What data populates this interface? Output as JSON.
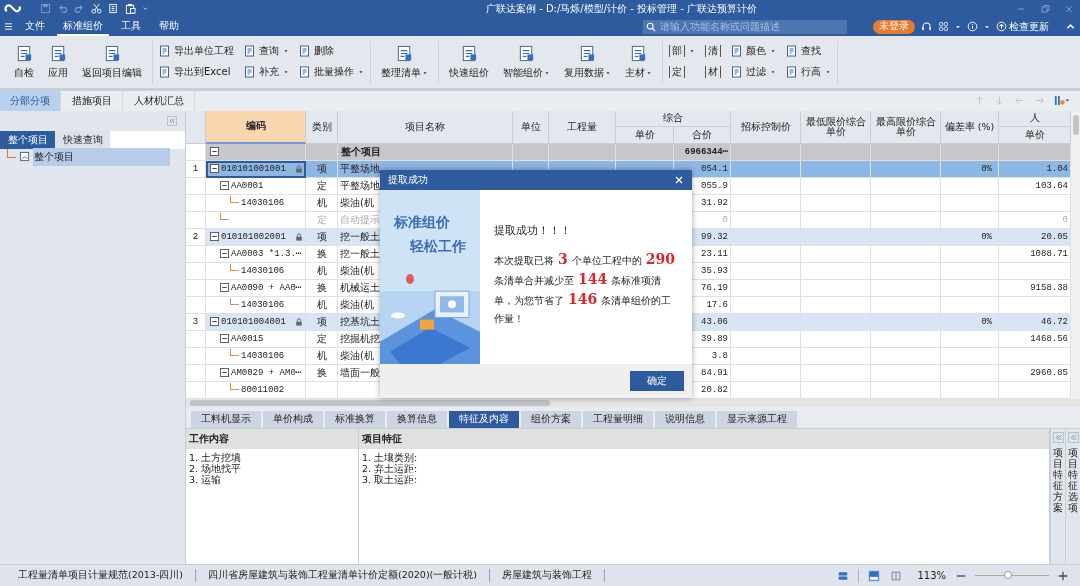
{
  "window": {
    "title": "广联达案例 - D:/马烁/模型/计价 - 投标管理 - 广联达预算计价"
  },
  "menu": [
    {
      "label": "文件",
      "selected": false
    },
    {
      "label": "标准组价",
      "selected": true
    },
    {
      "label": "工具",
      "selected": false
    },
    {
      "label": "帮助",
      "selected": false
    }
  ],
  "search": {
    "placeholder": "请输入功能名称或问题描述"
  },
  "account": {
    "login_label": "未登录",
    "update_label": "检查更新"
  },
  "ribbon": [
    {
      "kind": "large",
      "items": [
        {
          "label": "自检",
          "dropdown": false
        },
        {
          "label": "应用",
          "dropdown": false
        },
        {
          "label": "返回项目编辑",
          "dropdown": false
        }
      ]
    },
    {
      "kind": "small",
      "items": [
        {
          "kind": "text",
          "label": "导出单位工程",
          "dropdown": false
        },
        {
          "kind": "text",
          "label": "导出到Excel",
          "dropdown": false
        },
        {
          "kind": "text",
          "label": "查询",
          "dropdown": true
        },
        {
          "kind": "text",
          "label": "补充",
          "dropdown": true
        },
        {
          "kind": "text",
          "label": "删除",
          "dropdown": false
        },
        {
          "kind": "text",
          "label": "批量操作",
          "dropdown": true
        }
      ]
    },
    {
      "kind": "large",
      "items": [
        {
          "label": "整理清单",
          "dropdown": true
        }
      ]
    },
    {
      "kind": "large",
      "items": [
        {
          "label": "快速组价",
          "dropdown": false
        },
        {
          "label": "智能组价",
          "dropdown": true
        },
        {
          "label": "复用数据",
          "dropdown": true
        },
        {
          "label": "主材",
          "dropdown": true
        }
      ]
    },
    {
      "kind": "small",
      "items": [
        {
          "kind": "glyph",
          "label": "部",
          "dropdown": true
        },
        {
          "kind": "glyph",
          "label": "定",
          "dropdown": false
        },
        {
          "kind": "glyph",
          "label": "清",
          "dropdown": false
        },
        {
          "kind": "glyph",
          "label": "材",
          "dropdown": false
        },
        {
          "kind": "text",
          "label": "颜色",
          "dropdown": true
        },
        {
          "kind": "text",
          "label": "过滤",
          "dropdown": true
        },
        {
          "kind": "text",
          "label": "查找",
          "dropdown": false
        },
        {
          "kind": "text",
          "label": "行高",
          "dropdown": true
        }
      ]
    }
  ],
  "view_tabs": [
    {
      "label": "分部分项",
      "selected": true
    },
    {
      "label": "措施项目",
      "selected": false
    },
    {
      "label": "人材机汇总",
      "selected": false
    }
  ],
  "side_panel": {
    "tabs": [
      {
        "label": "整个项目",
        "selected": true
      },
      {
        "label": "快速查询",
        "selected": false
      }
    ],
    "tree": [
      {
        "label": "整个项目",
        "selected": true
      }
    ]
  },
  "table": {
    "columns": [
      {
        "label": "编码",
        "selected": true
      },
      {
        "label": "类别",
        "selected": false
      },
      {
        "label": "项目名称",
        "selected": false
      },
      {
        "label": "单位",
        "selected": false
      },
      {
        "label": "工程量",
        "selected": false
      },
      {
        "label": "综合",
        "selected": false,
        "children": [
          {
            "label": "单价"
          },
          {
            "label": "合价"
          }
        ]
      },
      {
        "label": "招标控制价",
        "selected": false
      },
      {
        "label": "最低限价综合单价",
        "selected": false
      },
      {
        "label": "最高限价综合单价",
        "selected": false
      },
      {
        "label": "偏差率 (%)",
        "selected": false
      },
      {
        "label": "人",
        "selected": false,
        "children": [
          {
            "label": "单价"
          }
        ]
      }
    ],
    "rows": [
      {
        "kind": "root",
        "name": "整个项目",
        "total": "6966344⋯",
        "expanded": true,
        "selected": false,
        "children": [
          {
            "kind": "bill",
            "index": "1",
            "code": "010101001001",
            "locked": true,
            "type": "项",
            "name": "平整场地",
            "total": "054.1",
            "deviation": "0%",
            "labor_price": "1.04",
            "expanded": true,
            "selected": true,
            "children": [
              {
                "kind": "entry",
                "code": "AA0001",
                "type": "定",
                "name": "平整场地",
                "total": "055.9",
                "labor_price": "103.64",
                "expanded": true,
                "selected": false,
                "children": [
                  {
                    "kind": "entry",
                    "code": "14030106",
                    "type": "机",
                    "name": "柴油(机",
                    "total": "31.92",
                    "selected": false
                  }
                ]
              },
              {
                "kind": "hint",
                "type": "定",
                "name": "自动提示",
                "total": "0",
                "labor_price": "0",
                "selected": false
              }
            ]
          },
          {
            "kind": "bill",
            "index": "2",
            "code": "010101002001",
            "locked": true,
            "type": "项",
            "name": "挖一般土",
            "total": "99.32",
            "deviation": "0%",
            "labor_price": "20.05",
            "expanded": true,
            "selected": false,
            "children": [
              {
                "kind": "entry",
                "code": "AA0003 *1.3.⋯",
                "type": "换",
                "name": "挖一般土",
                "total": "23.11",
                "labor_price": "1088.71",
                "expanded": true,
                "selected": false,
                "children": [
                  {
                    "kind": "entry",
                    "code": "14030106",
                    "type": "机",
                    "name": "柴油(机",
                    "total": "35.93",
                    "selected": false
                  }
                ]
              },
              {
                "kind": "entry",
                "code": "AA0090 + AA0⋯",
                "type": "换",
                "name": "机械运土",
                "total": "76.19",
                "labor_price": "9158.38",
                "expanded": true,
                "selected": false,
                "children": [
                  {
                    "kind": "entry",
                    "code": "14030106",
                    "type": "机",
                    "name": "柴油(机",
                    "total": "17.6",
                    "selected": false
                  }
                ]
              }
            ]
          },
          {
            "kind": "bill",
            "index": "3",
            "code": "010101004001",
            "locked": true,
            "type": "项",
            "name": "挖基坑土",
            "total": "43.06",
            "deviation": "0%",
            "labor_price": "46.72",
            "expanded": true,
            "selected": false,
            "children": [
              {
                "kind": "entry",
                "code": "AA0015",
                "type": "定",
                "name": "挖掘机挖",
                "total": "39.89",
                "labor_price": "1468.56",
                "expanded": true,
                "selected": false,
                "children": [
                  {
                    "kind": "entry",
                    "code": "14030106",
                    "type": "机",
                    "name": "柴油(机",
                    "total": "3.8",
                    "selected": false
                  }
                ]
              },
              {
                "kind": "entry",
                "code": "AM0029 + AM0⋯",
                "type": "换",
                "name": "墙面一般",
                "total": "84.91",
                "labor_price": "2960.85",
                "expanded": true,
                "selected": false,
                "children": [
                  {
                    "kind": "entry",
                    "code": "80011002",
                    "total": "20.82",
                    "selected": false
                  }
                ]
              }
            ]
          }
        ]
      }
    ]
  },
  "dialog": {
    "title": "提取成功",
    "banner_lines": [
      "标准组价",
      "轻松工作"
    ],
    "heading": "提取成功！！！",
    "message": "本次提取已将 **3** 个单位工程中的 **290** 条清单合并减少至 **144** 条标准项清单，为您节省了 **146** 条清单组价的工作量！",
    "ok_label": "确定"
  },
  "detail_tabs": [
    {
      "label": "工料机显示",
      "selected": false
    },
    {
      "label": "单价构成",
      "selected": false
    },
    {
      "label": "标准换算",
      "selected": false
    },
    {
      "label": "换算信息",
      "selected": false
    },
    {
      "label": "特征及内容",
      "selected": true
    },
    {
      "label": "组价方案",
      "selected": false
    },
    {
      "label": "工程量明细",
      "selected": false
    },
    {
      "label": "说明信息",
      "selected": false
    },
    {
      "label": "显示来源工程",
      "selected": false
    }
  ],
  "detail": {
    "work_content": {
      "title": "工作内容",
      "lines": [
        "1. 土方挖填",
        "2. 场地找平",
        "3. 运输"
      ]
    },
    "features": {
      "title": "项目特征",
      "lines": [
        "1. 土壤类别:",
        "2. 弃土运距:",
        "3. 取土运距:"
      ]
    },
    "side_tabs": [
      "项目特征方案",
      "项目特征选项"
    ]
  },
  "status_bar": {
    "items": [
      "工程量清单项目计量规范(2013-四川)",
      "四川省房屋建筑与装饰工程量清单计价定额(2020)(一般计税)",
      "房屋建筑与装饰工程"
    ],
    "zoom": "113%",
    "zoom_slider": {
      "level": 0.45
    }
  }
}
